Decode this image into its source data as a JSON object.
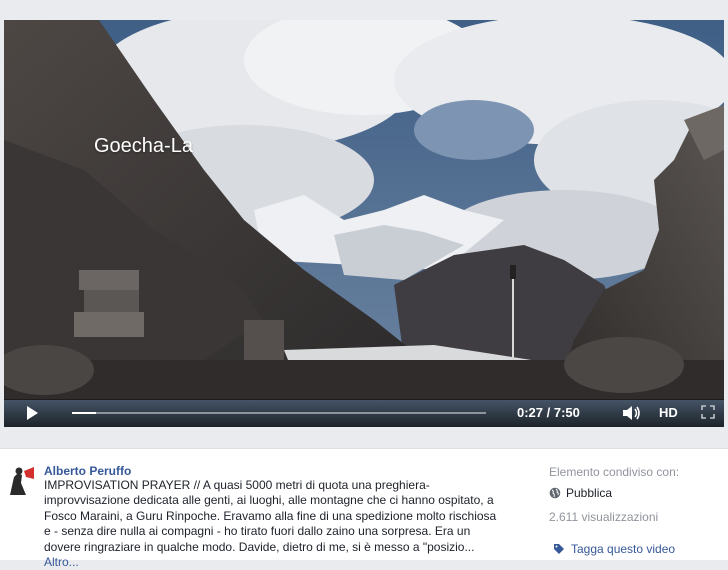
{
  "video": {
    "overlay_title": "Goecha-La",
    "time_display": "0:27 / 7:50",
    "progress": 0.057,
    "hd_label": "HD"
  },
  "post": {
    "author": "Alberto Peruffo",
    "description": "IMPROVISATION PRAYER // A quasi 5000 metri di quota una preghiera-improvvisazione dedicata alle genti, ai luoghi, alle montagne che ci hanno ospitato, a Fosco Maraini, a Guru Rinpoche. Eravamo alla fine di una spedizione molto rischiosa e - senza dire nulla ai compagni - ho tirato fuori dallo zaino una sorpresa. Era un dovere ringraziare in qualche modo. Davide, dietro di me, si è messo a \"posizio...",
    "more_label": "Altro..."
  },
  "sidebar": {
    "shared_label": "Elemento condiviso con:",
    "privacy_label": "Pubblica",
    "views": "2.611 visualizzazioni",
    "tag_label": "Tagga questo video"
  },
  "icons": {
    "play": "play-icon",
    "volume": "volume-icon",
    "fullscreen": "fullscreen-icon",
    "globe": "globe-icon",
    "tag": "tag-icon"
  },
  "colors": {
    "link": "#365899",
    "muted": "#90949c",
    "text": "#1d2129",
    "page_bg": "#e9ebee"
  }
}
